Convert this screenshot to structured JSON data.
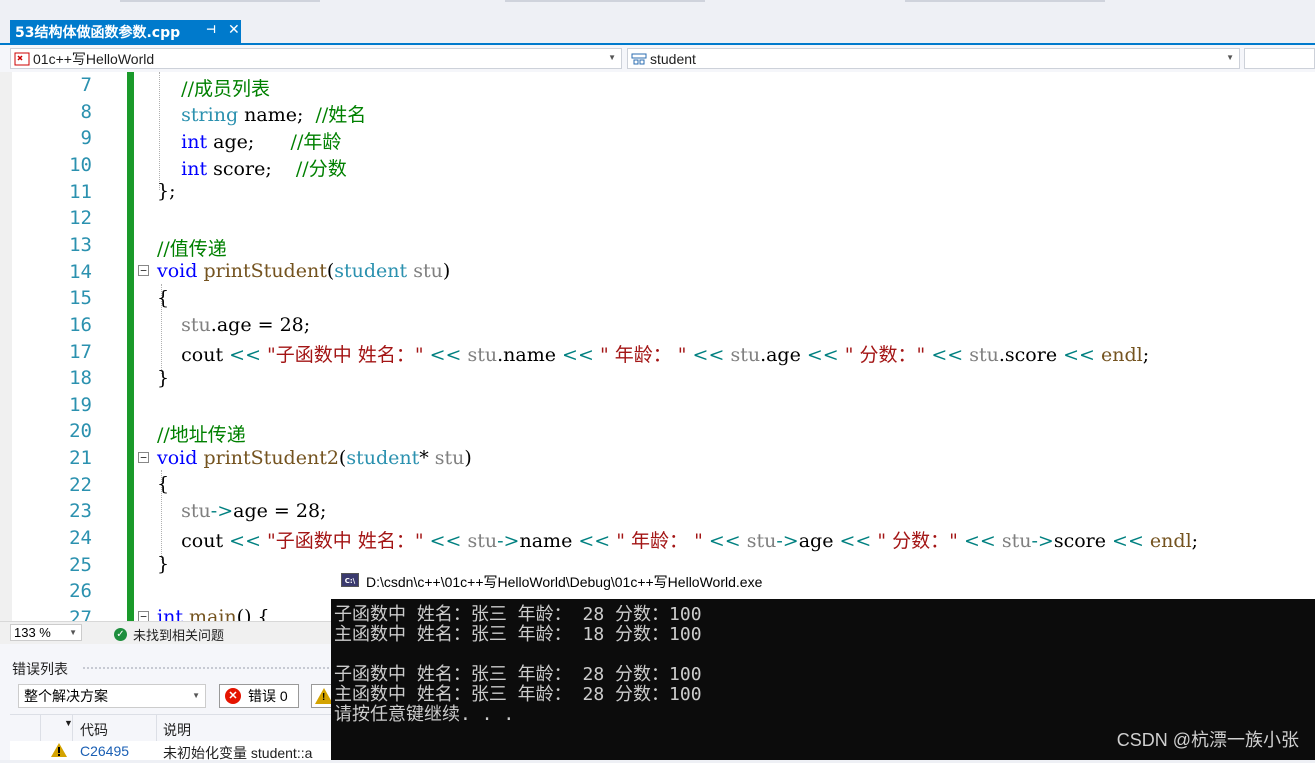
{
  "tab": {
    "title": "53结构体做函数参数.cpp",
    "pin": "⊣",
    "close": "✕"
  },
  "nav": {
    "project": "01c++写HelloWorld",
    "scope": "student"
  },
  "editor": {
    "line_numbers": [
      "7",
      "8",
      "9",
      "10",
      "11",
      "12",
      "13",
      "14",
      "15",
      "16",
      "17",
      "18",
      "19",
      "20",
      "21",
      "22",
      "23",
      "24",
      "25",
      "26",
      "27"
    ]
  },
  "status": {
    "zoom": "133 %",
    "issues": "未找到相关问题"
  },
  "error_list": {
    "title": "错误列表",
    "scope": "整个解决方案",
    "errors_label": "错误 0",
    "columns": [
      "代码",
      "说明"
    ],
    "rows": [
      {
        "code": "C26495",
        "description": "未初始化变量 student::a"
      }
    ]
  },
  "console": {
    "title": "D:\\csdn\\c++\\01c++写HelloWorld\\Debug\\01c++写HelloWorld.exe",
    "lines": [
      "子函数中 姓名：张三 年龄： 28 分数：100",
      "主函数中 姓名：张三 年龄： 18 分数：100",
      "",
      "子函数中 姓名：张三 年龄： 28 分数：100",
      "主函数中 姓名：张三 年龄： 28 分数：100",
      "请按任意键继续. . ."
    ]
  },
  "watermark": "CSDN @杭漂一族小张"
}
